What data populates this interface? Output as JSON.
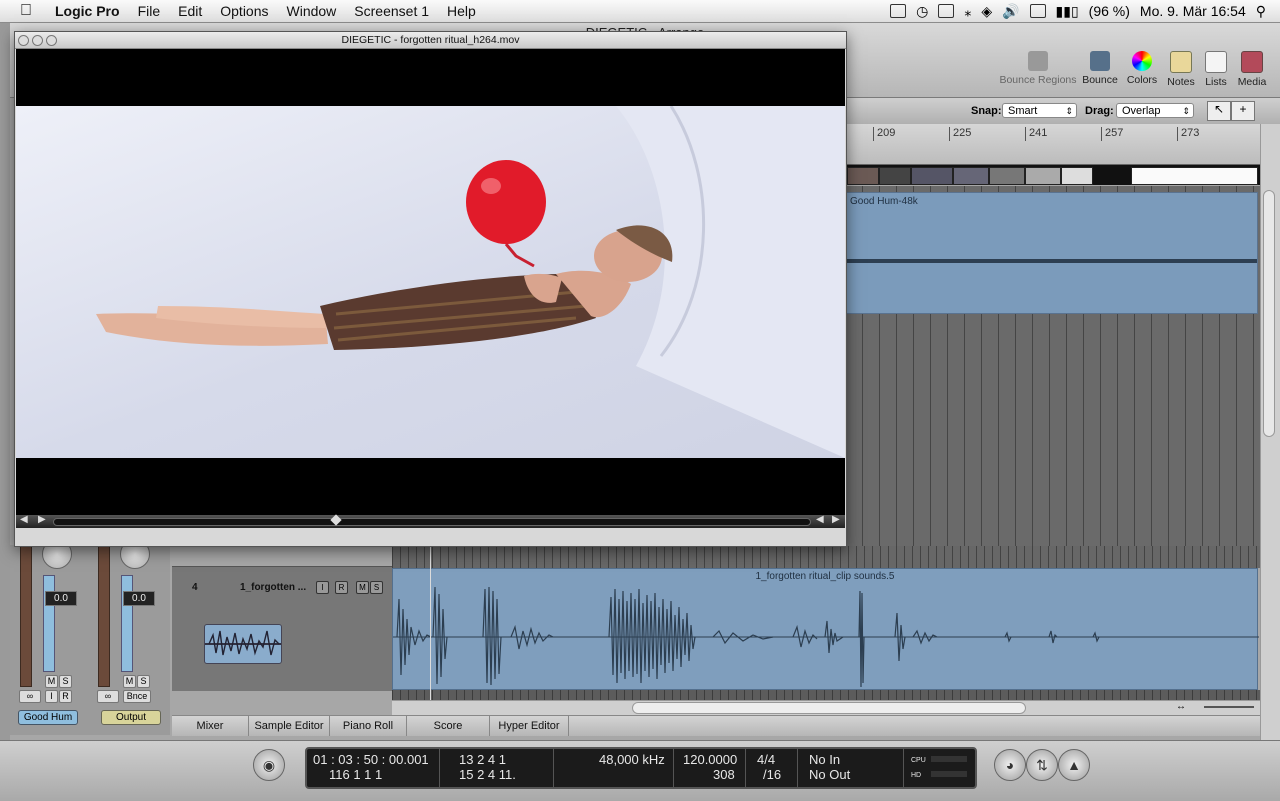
{
  "menubar": {
    "app_name": "Logic Pro",
    "items": [
      "File",
      "Edit",
      "Options",
      "Window",
      "Screenset 1",
      "Help"
    ],
    "battery": "(96 %)",
    "datetime": "Mo. 9. Mär  16:54"
  },
  "arrange": {
    "title": "DIEGETIC - Arrange",
    "toolbar": [
      "Bounce Regions",
      "Bounce",
      "Colors",
      "Notes",
      "Lists",
      "Media"
    ],
    "snap_label": "Snap:",
    "snap_value": "Smart",
    "drag_label": "Drag:",
    "drag_value": "Overlap",
    "ruler": [
      "209",
      "225",
      "241",
      "257",
      "273"
    ],
    "region_top": "Good Hum-48k"
  },
  "movie_window": {
    "title": "DIEGETIC - forgotten ritual_h264.mov"
  },
  "mixer": {
    "ch1": {
      "value": "0.0",
      "name": "Good Hum",
      "btn_m": "M",
      "btn_s": "S",
      "btn_i": "I",
      "btn_r": "R"
    },
    "ch2": {
      "value": "0.0",
      "name": "Output",
      "btn_m": "M",
      "btn_s": "S",
      "btn_bnce": "Bnce"
    }
  },
  "track": {
    "number": "4",
    "name": "1_forgotten ...",
    "btns": [
      "I",
      "R",
      "M",
      "S"
    ],
    "region_name": "1_forgotten ritual_clip sounds.5"
  },
  "tabs": [
    "Mixer",
    "Sample Editor",
    "Piano Roll",
    "Score",
    "Hyper Editor"
  ],
  "transport": {
    "smpte": "01 : 03 : 50 : 00.001",
    "smpte_bits": "116   1   1     1",
    "bars": "13   2   4     1",
    "bars2": "15   2   4   11.",
    "sample_rate": "48,000 kHz",
    "tempo": "120.0000",
    "tempo2": "308",
    "signature": "4/4",
    "division": "/16",
    "in": "No In",
    "out": "No Out",
    "cpu": "CPU",
    "hd": "HD"
  }
}
